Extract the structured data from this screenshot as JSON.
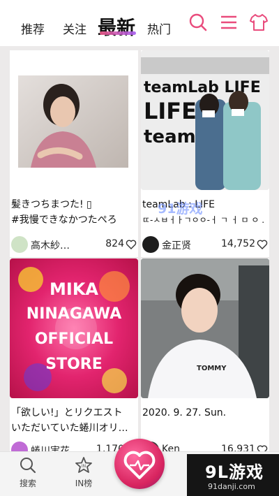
{
  "header": {
    "tabs": [
      "推荐",
      "关注",
      "最新",
      "热门"
    ],
    "active_tab": "最新",
    "accent": "#e94b7c"
  },
  "cards": [
    {
      "caption_line1": "髪きつちまつた! ▯",
      "caption_line2": "#我慢できなかつたぺろ",
      "user": "高木紗…",
      "likes": "824"
    },
    {
      "caption_line1": "teamLab : LIFE",
      "caption_line2": "ㄸ-ㅅㅂㅓㅏㄱㅇㅇ-ㅓ ㄱ ㅓ ㅁ ㅇ .",
      "user": "金正贤",
      "likes": "14,752",
      "image_text": [
        "teamLab LIFE",
        "LIFE",
        "team"
      ]
    },
    {
      "caption_line1": "「欲しい!」とリクエスト",
      "caption_line2": "いただいていた蜷川オリ…",
      "user": "蜷川実花",
      "likes": "1,170",
      "image_text": [
        "MIKA",
        "NINAGAWA",
        "OFFICIAL",
        "STORE"
      ]
    },
    {
      "caption_line1": "2020. 9. 27. Sun.",
      "caption_line2": "",
      "user": "Ken",
      "likes": "16,931",
      "image_text": [
        "TOMMY"
      ]
    }
  ],
  "overlay_watermark": "91游戏",
  "bottom_nav": {
    "search": "搜索",
    "in_rank": "IN榜"
  },
  "watermark": {
    "logo": "9L游戏",
    "url": "91danji.com"
  }
}
